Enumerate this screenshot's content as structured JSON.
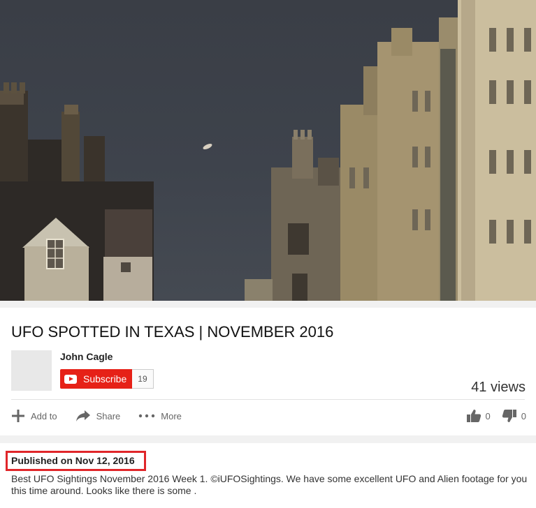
{
  "video": {
    "title": "UFO SPOTTED IN TEXAS | NOVEMBER 2016"
  },
  "channel": {
    "name": "John Cagle",
    "subscribe_label": "Subscribe",
    "subscriber_count": "19"
  },
  "stats": {
    "views": "41 views",
    "likes": "0",
    "dislikes": "0"
  },
  "actions": {
    "add_to": "Add to",
    "share": "Share",
    "more": "More"
  },
  "description": {
    "published": "Published on Nov 12, 2016",
    "text": "Best UFO Sightings November 2016 Week 1. ©iUFOSightings. We have some excellent UFO and Alien footage for you this time around. Looks like there is some ."
  },
  "colors": {
    "subscribe_red": "#e62117",
    "highlight_box": "#e0262a",
    "page_bg": "#f1f1f1"
  },
  "icons": [
    "youtube-play-icon",
    "plus-icon",
    "share-arrow-icon",
    "more-dots-icon",
    "thumbs-up-icon",
    "thumbs-down-icon"
  ]
}
